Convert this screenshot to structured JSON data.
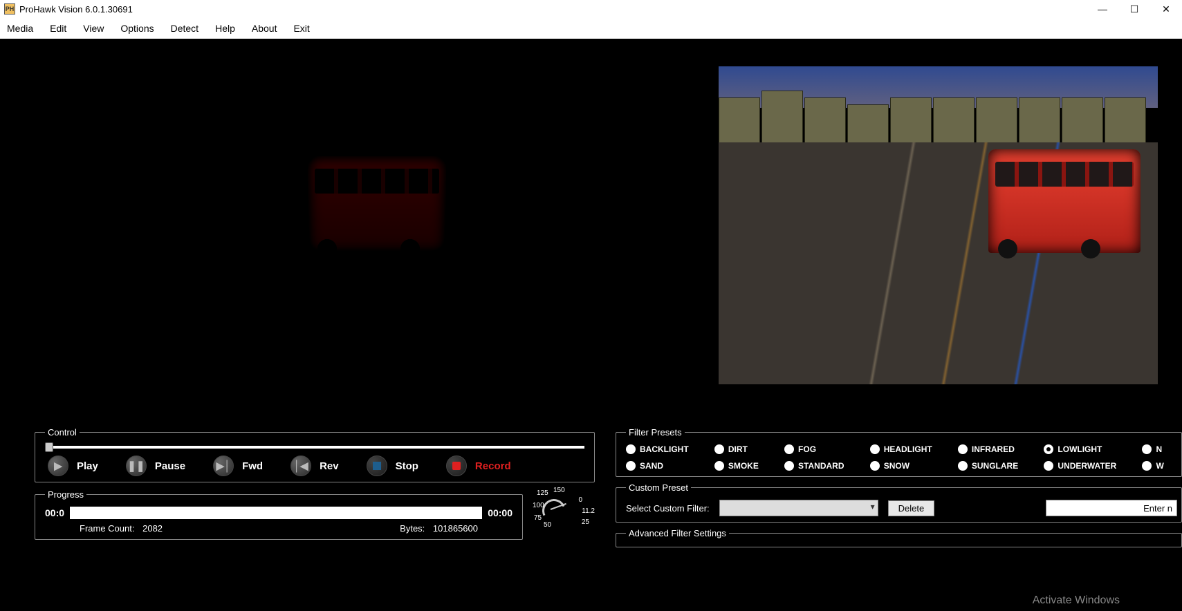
{
  "window": {
    "title": "ProHawk Vision 6.0.1.30691"
  },
  "menu": [
    "Media",
    "Edit",
    "View",
    "Options",
    "Detect",
    "Help",
    "About",
    "Exit"
  ],
  "control": {
    "legend": "Control",
    "play": "Play",
    "pause": "Pause",
    "fwd": "Fwd",
    "rev": "Rev",
    "stop": "Stop",
    "record": "Record"
  },
  "progress": {
    "legend": "Progress",
    "time_left": "00:0",
    "time_right": "00:00",
    "frame_label": "Frame Count:",
    "frame_value": "2082",
    "bytes_label": "Bytes:",
    "bytes_value": "101865600"
  },
  "gauge": {
    "g100": "100",
    "g125": "125",
    "g150": "150",
    "g75": "75",
    "g50": "50",
    "g25": "25",
    "g0": "0",
    "g112": "11.2"
  },
  "filter_presets": {
    "legend": "Filter Presets",
    "items": [
      {
        "label": "BACKLIGHT",
        "selected": false
      },
      {
        "label": "DIRT",
        "selected": false
      },
      {
        "label": "FOG",
        "selected": false
      },
      {
        "label": "HEADLIGHT",
        "selected": false
      },
      {
        "label": "INFRARED",
        "selected": false
      },
      {
        "label": "LOWLIGHT",
        "selected": true
      },
      {
        "label": "N",
        "selected": false
      },
      {
        "label": "SAND",
        "selected": false
      },
      {
        "label": "SMOKE",
        "selected": false
      },
      {
        "label": "STANDARD",
        "selected": false
      },
      {
        "label": "SNOW",
        "selected": false
      },
      {
        "label": "SUNGLARE",
        "selected": false
      },
      {
        "label": "UNDERWATER",
        "selected": false
      },
      {
        "label": "W",
        "selected": false
      }
    ]
  },
  "custom_preset": {
    "legend": "Custom Preset",
    "select_label": "Select Custom Filter:",
    "delete": "Delete",
    "entry_placeholder": "Enter n"
  },
  "advanced": {
    "legend": "Advanced Filter Settings"
  },
  "watermark": "Activate Windows"
}
